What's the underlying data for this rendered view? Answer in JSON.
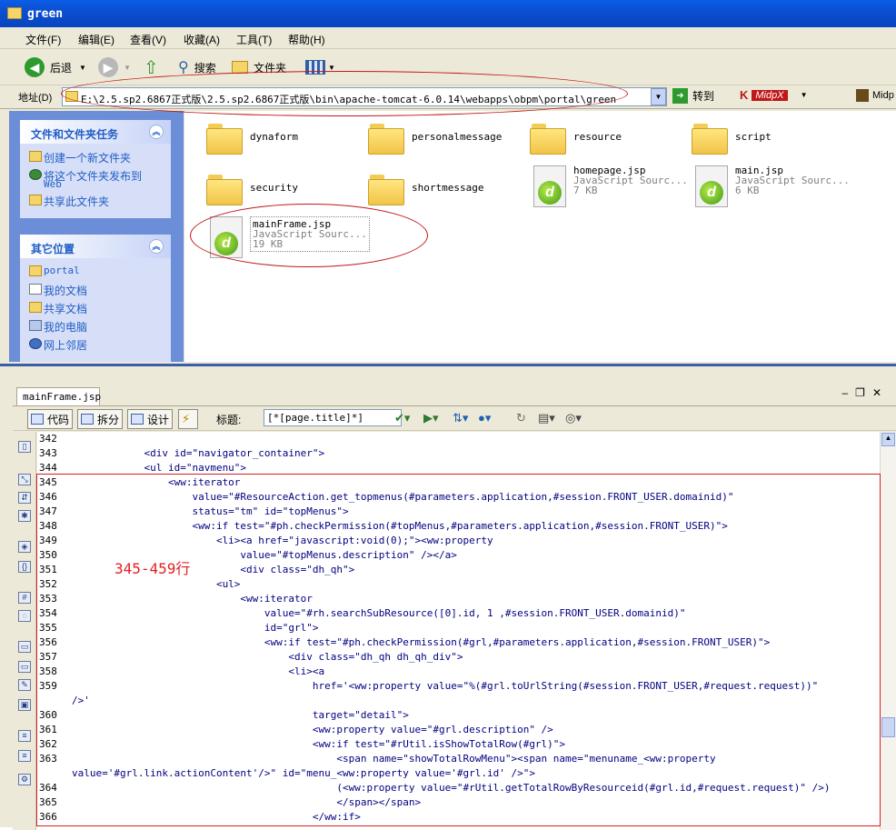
{
  "window": {
    "title": "green"
  },
  "menu": [
    "文件(F)",
    "编辑(E)",
    "查看(V)",
    "收藏(A)",
    "工具(T)",
    "帮助(H)"
  ],
  "toolbar": {
    "back": "后退",
    "search": "搜索",
    "folders": "文件夹"
  },
  "address": {
    "label": "地址(D)",
    "path": "E:\\2.5.sp2.6867正式版\\2.5.sp2.6867正式版\\bin\\apache-tomcat-6.0.14\\webapps\\obpm\\portal\\green",
    "go": "转到",
    "midpx": "MidpX",
    "midp": "Midp"
  },
  "tasks": {
    "file_tasks": {
      "title": "文件和文件夹任务",
      "items": [
        "创建一个新文件夹",
        "将这个文件夹发布到",
        "Web",
        "共享此文件夹"
      ]
    },
    "other_places": {
      "title": "其它位置",
      "items": [
        "portal",
        "我的文档",
        "共享文档",
        "我的电脑",
        "网上邻居"
      ]
    }
  },
  "files": [
    {
      "name": "dynaform",
      "type": "folder"
    },
    {
      "name": "personalmessage",
      "type": "folder"
    },
    {
      "name": "resource",
      "type": "folder"
    },
    {
      "name": "script",
      "type": "folder"
    },
    {
      "name": "security",
      "type": "folder"
    },
    {
      "name": "shortmessage",
      "type": "folder"
    },
    {
      "name": "homepage.jsp",
      "type": "JavaScript Sourc...",
      "size": "7 KB"
    },
    {
      "name": "main.jsp",
      "type": "JavaScript Sourc...",
      "size": "6 KB"
    },
    {
      "name": "mainFrame.jsp",
      "type": "JavaScript Sourc...",
      "size": "19 KB"
    }
  ],
  "editor": {
    "tab": "mainFrame.jsp",
    "view_code": "代码",
    "view_split": "拆分",
    "view_design": "设计",
    "title_label": "标题:",
    "title_value": "[*[page.title]*]",
    "annotation": "345-459行",
    "lines": [
      {
        "n": "342",
        "t": ""
      },
      {
        "n": "343",
        "t": "            <div id=\"navigator_container\">"
      },
      {
        "n": "344",
        "t": "            <ul id=\"navmenu\">"
      },
      {
        "n": "345",
        "t": "                <ww:iterator"
      },
      {
        "n": "346",
        "t": "                    value=\"#ResourceAction.get_topmenus(#parameters.application,#session.FRONT_USER.domainid)\""
      },
      {
        "n": "347",
        "t": "                    status=\"tm\" id=\"topMenus\">"
      },
      {
        "n": "348",
        "t": "                    <ww:if test=\"#ph.checkPermission(#topMenus,#parameters.application,#session.FRONT_USER)\">"
      },
      {
        "n": "349",
        "t": "                        <li><a href=\"javascript:void(0);\"><ww:property"
      },
      {
        "n": "350",
        "t": "                            value=\"#topMenus.description\" /></a>"
      },
      {
        "n": "351",
        "t": "                            <div class=\"dh_qh\">"
      },
      {
        "n": "352",
        "t": "                        <ul>"
      },
      {
        "n": "353",
        "t": "                            <ww:iterator"
      },
      {
        "n": "354",
        "t": "                                value=\"#rh.searchSubResource([0].id, 1 ,#session.FRONT_USER.domainid)\""
      },
      {
        "n": "355",
        "t": "                                id=\"grl\">"
      },
      {
        "n": "356",
        "t": "                                <ww:if test=\"#ph.checkPermission(#grl,#parameters.application,#session.FRONT_USER)\">"
      },
      {
        "n": "357",
        "t": "                                    <div class=\"dh_qh dh_qh_div\">"
      },
      {
        "n": "358",
        "t": "                                    <li><a"
      },
      {
        "n": "359",
        "t": "                                        href='<ww:property value=\"%(#grl.toUrlString(#session.FRONT_USER,#request.request))\""
      },
      {
        "n": "",
        "t": "/>'"
      },
      {
        "n": "360",
        "t": "                                        target=\"detail\">"
      },
      {
        "n": "361",
        "t": "                                        <ww:property value=\"#grl.description\" />"
      },
      {
        "n": "362",
        "t": "                                        <ww:if test=\"#rUtil.isShowTotalRow(#grl)\">"
      },
      {
        "n": "363",
        "t": "                                            <span name=\"showTotalRowMenu\"><span name=\"menuname_<ww:property"
      },
      {
        "n": "",
        "t": "value='#grl.link.actionContent'/>\" id=\"menu_<ww:property value='#grl.id' />\">"
      },
      {
        "n": "364",
        "t": "                                            (<ww:property value=\"#rUtil.getTotalRowByResourceid(#grl.id,#request.request)\" />)"
      },
      {
        "n": "365",
        "t": "                                            </span></span>"
      },
      {
        "n": "366",
        "t": "                                        </ww:if>"
      }
    ]
  }
}
